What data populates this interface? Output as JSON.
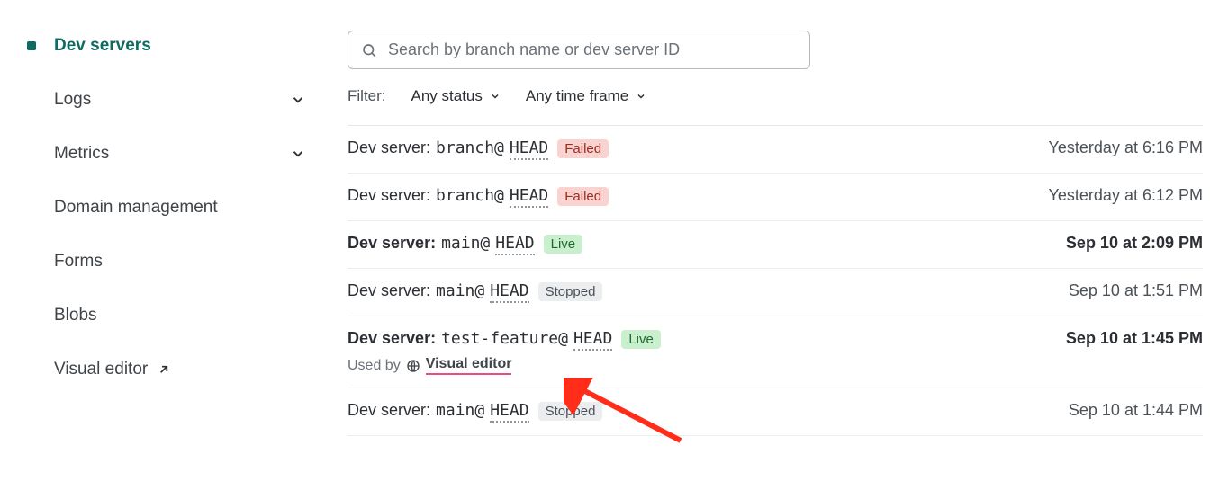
{
  "sidebar": {
    "items": [
      {
        "label": "Dev servers",
        "active": true,
        "expandable": false,
        "external": false
      },
      {
        "label": "Logs",
        "active": false,
        "expandable": true,
        "external": false
      },
      {
        "label": "Metrics",
        "active": false,
        "expandable": true,
        "external": false
      },
      {
        "label": "Domain management",
        "active": false,
        "expandable": false,
        "external": false
      },
      {
        "label": "Forms",
        "active": false,
        "expandable": false,
        "external": false
      },
      {
        "label": "Blobs",
        "active": false,
        "expandable": false,
        "external": false
      },
      {
        "label": "Visual editor",
        "active": false,
        "expandable": false,
        "external": true
      }
    ]
  },
  "search": {
    "placeholder": "Search by branch name or dev server ID"
  },
  "filter": {
    "label": "Filter:",
    "status": "Any status",
    "timeframe": "Any time frame"
  },
  "row_prefix": "Dev server: ",
  "used_by_label": "Used by",
  "visual_editor_label": "Visual editor",
  "statuses": {
    "failed": "Failed",
    "live": "Live",
    "stopped": "Stopped"
  },
  "rows": [
    {
      "branch": "branch",
      "head": "HEAD",
      "status": "failed",
      "bold": false,
      "time": "Yesterday at 6:16 PM",
      "used_by_ve": false
    },
    {
      "branch": "branch",
      "head": "HEAD",
      "status": "failed",
      "bold": false,
      "time": "Yesterday at 6:12 PM",
      "used_by_ve": false
    },
    {
      "branch": "main",
      "head": "HEAD",
      "status": "live",
      "bold": true,
      "time": "Sep 10 at 2:09 PM",
      "used_by_ve": false
    },
    {
      "branch": "main",
      "head": "HEAD",
      "status": "stopped",
      "bold": false,
      "time": "Sep 10 at 1:51 PM",
      "used_by_ve": false
    },
    {
      "branch": "test-feature",
      "head": "HEAD",
      "status": "live",
      "bold": true,
      "time": "Sep 10 at 1:45 PM",
      "used_by_ve": true
    },
    {
      "branch": "main",
      "head": "HEAD",
      "status": "stopped",
      "bold": false,
      "time": "Sep 10 at 1:44 PM",
      "used_by_ve": false
    }
  ]
}
